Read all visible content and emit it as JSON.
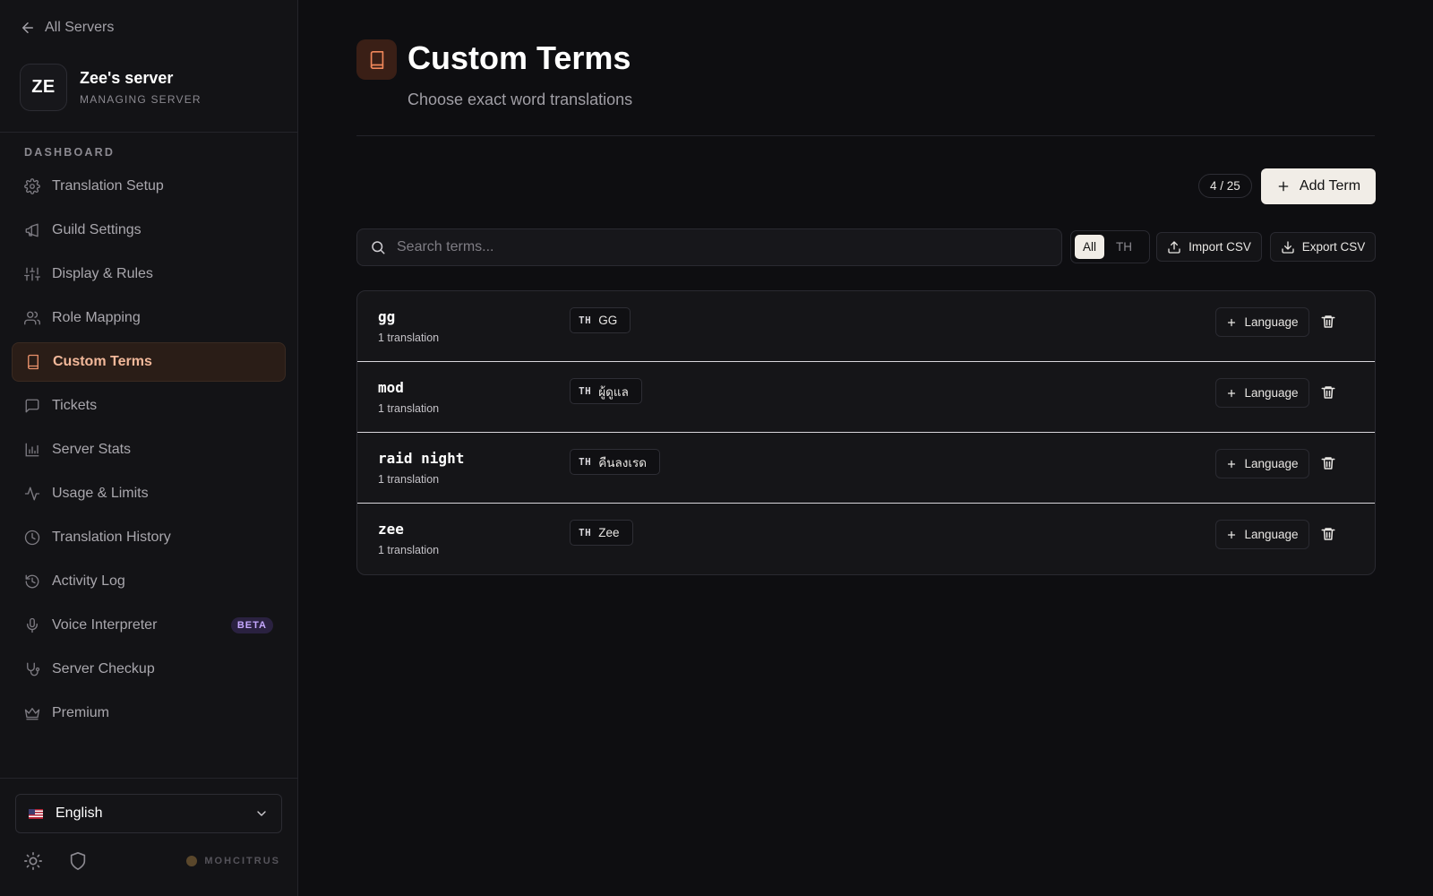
{
  "sidebar": {
    "back_label": "All Servers",
    "server": {
      "initials": "ZE",
      "name": "Zee's server",
      "subtitle": "MANAGING SERVER"
    },
    "section_title": "DASHBOARD",
    "items": [
      {
        "label": "Translation Setup",
        "icon": "gear-icon",
        "active": false
      },
      {
        "label": "Guild Settings",
        "icon": "megaphone-icon",
        "active": false
      },
      {
        "label": "Display & Rules",
        "icon": "sliders-icon",
        "active": false
      },
      {
        "label": "Role Mapping",
        "icon": "users-icon",
        "active": false
      },
      {
        "label": "Custom Terms",
        "icon": "book-icon",
        "active": true
      },
      {
        "label": "Tickets",
        "icon": "chat-icon",
        "active": false
      },
      {
        "label": "Server Stats",
        "icon": "bar-chart-icon",
        "active": false
      },
      {
        "label": "Usage & Limits",
        "icon": "activity-icon",
        "active": false
      },
      {
        "label": "Translation History",
        "icon": "clock-icon",
        "active": false
      },
      {
        "label": "Activity Log",
        "icon": "history-icon",
        "active": false
      },
      {
        "label": "Voice Interpreter",
        "icon": "mic-icon",
        "active": false,
        "badge": "BETA"
      },
      {
        "label": "Server Checkup",
        "icon": "stethoscope-icon",
        "active": false
      },
      {
        "label": "Premium",
        "icon": "crown-icon",
        "active": false
      }
    ],
    "language": {
      "label": "English",
      "flag": "us-flag-icon"
    },
    "footer": {
      "brand": "MOHCITRUS"
    }
  },
  "main": {
    "title": "Custom Terms",
    "subtitle": "Choose exact word translations",
    "count": "4 / 25",
    "add_label": "Add Term",
    "search_placeholder": "Search terms...",
    "filters": [
      "All",
      "TH"
    ],
    "active_filter": "All",
    "import_label": "Import CSV",
    "export_label": "Export CSV",
    "language_button_label": "Language",
    "terms": [
      {
        "word": "gg",
        "count": "1 translation",
        "lang": "TH",
        "translation": "GG"
      },
      {
        "word": "mod",
        "count": "1 translation",
        "lang": "TH",
        "translation": "ผู้ดูแล"
      },
      {
        "word": "raid night",
        "count": "1 translation",
        "lang": "TH",
        "translation": "คืนลงเรด"
      },
      {
        "word": "zee",
        "count": "1 translation",
        "lang": "TH",
        "translation": "Zee"
      }
    ]
  },
  "colors": {
    "accent": "#f0875a",
    "active_bg": "#2a1d17",
    "background": "#0e0e11",
    "beta": "#c6a8ff"
  }
}
